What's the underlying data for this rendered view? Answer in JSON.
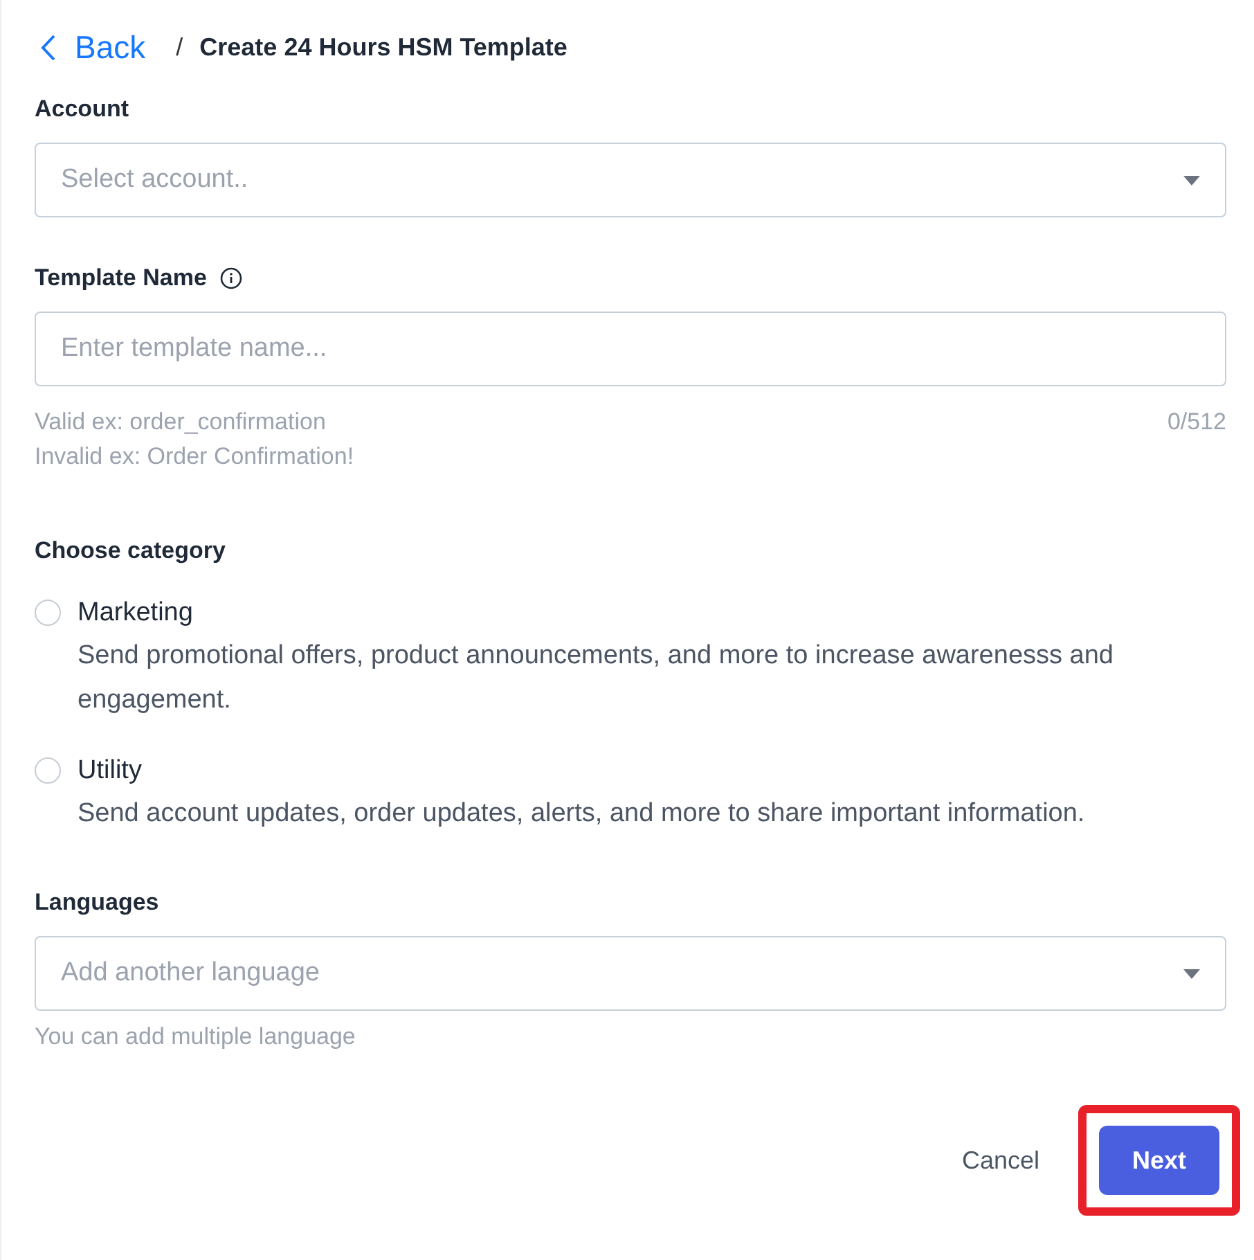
{
  "breadcrumb": {
    "back": "Back",
    "separator": "/",
    "title": "Create 24 Hours HSM Template"
  },
  "account": {
    "label": "Account",
    "placeholder": "Select account.."
  },
  "template_name": {
    "label": "Template Name",
    "placeholder": "Enter template name...",
    "hints": [
      "Valid ex: order_confirmation",
      "Invalid ex: Order Confirmation!"
    ],
    "counter": "0/512"
  },
  "category": {
    "label": "Choose category",
    "options": [
      {
        "label": "Marketing",
        "description": "Send promotional offers, product announcements, and more to increase awarenesss and engagement.",
        "selected": false
      },
      {
        "label": "Utility",
        "description": "Send account updates, order updates, alerts, and more to share important information.",
        "selected": false
      }
    ]
  },
  "languages": {
    "label": "Languages",
    "placeholder": "Add another language",
    "hint": "You can add multiple language"
  },
  "buttons": [
    {
      "kind": "text",
      "label": "Cancel",
      "highlighted": false
    },
    {
      "kind": "primary",
      "label": "Next",
      "highlighted": true
    }
  ]
}
